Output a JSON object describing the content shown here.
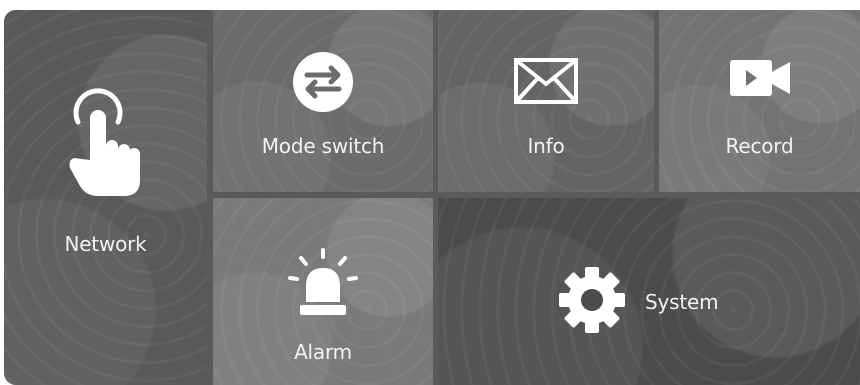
{
  "menu": {
    "tiles": [
      {
        "label": "Network",
        "icon": "touch-hand-icon"
      },
      {
        "label": "Mode switch",
        "icon": "swap-arrows-icon"
      },
      {
        "label": "Info",
        "icon": "envelope-icon"
      },
      {
        "label": "Record",
        "icon": "video-camera-icon"
      },
      {
        "label": "Alarm",
        "icon": "siren-light-icon"
      },
      {
        "label": "System",
        "icon": "gear-icon"
      }
    ]
  },
  "colors": {
    "icon": "#ffffff",
    "text": "#f2f2f2",
    "tile_dark": "#4c4c4c",
    "tile_mid": "#646464",
    "tile_light": "#7a7a7a"
  }
}
